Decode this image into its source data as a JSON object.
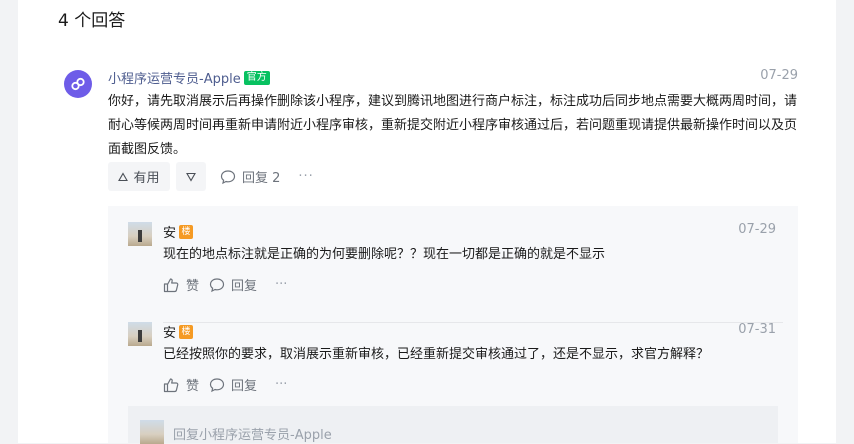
{
  "answers_header": {
    "count_label": "4 个回答"
  },
  "answer": {
    "author": "小程序运营专员-Apple",
    "badge": "官方",
    "date": "07-29",
    "body": "你好，请先取消展示后再操作删除该小程序，建议到腾讯地图进行商户标注，标注成功后同步地点需要大概两周时间，请耐心等候两周时间再重新申请附近小程序审核，重新提交附近小程序审核通过后，若问题重现请提供最新操作时间以及页面截图反馈。",
    "useful_label": "有用",
    "reply_label": "回复 2",
    "more": "···"
  },
  "replies": [
    {
      "name": "安",
      "floor_badge": "楼",
      "date": "07-29",
      "text": "现在的地点标注就是正确的为何要删除呢？？现在一切都是正确的就是不显示",
      "like_label": "赞",
      "reply_label": "回复",
      "more": "···"
    },
    {
      "name": "安",
      "floor_badge": "楼",
      "date": "07-31",
      "text": "已经按照你的要求，取消展示重新审核，已经重新提交审核通过了，还是不显示，求官方解释？",
      "like_label": "赞",
      "reply_label": "回复",
      "more": "···"
    }
  ],
  "nested_reply": {
    "text": "回复小程序运营专员-Apple"
  },
  "colors": {
    "official_green": "#07c160",
    "floor_orange": "#f59a23",
    "author_blue": "#4e5d8f",
    "avatar_purple": "#6e5ce8"
  }
}
